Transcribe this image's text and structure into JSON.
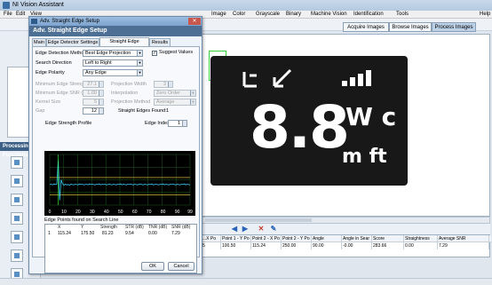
{
  "app": {
    "title": "NI Vision Assistant"
  },
  "menu": [
    "File",
    "Edit",
    "View",
    "Image",
    "Color",
    "Grayscale",
    "Binary",
    "Machine Vision",
    "Identification",
    "Tools",
    "Help"
  ],
  "view_buttons": [
    {
      "label": "Acquire Images",
      "active": false
    },
    {
      "label": "Browse Images",
      "active": false
    },
    {
      "label": "Process Images",
      "active": true
    }
  ],
  "left_panel": {
    "header": "Processing Functions"
  },
  "dialog": {
    "title": "Adv. Straight Edge Setup",
    "header": "Adv. Straight Edge Setup",
    "tabs": [
      "Main",
      "Edge Detector Settings",
      "Straight Edge Settings",
      "Results"
    ],
    "active_tab": "Straight Edge Settings",
    "edge_detection_method": {
      "label": "Edge Detection Method",
      "value": "Best Edge Projection"
    },
    "suggest_values": {
      "label": "Suggest Values",
      "checked": true
    },
    "search_direction": {
      "label": "Search Direction",
      "value": "Left to Right"
    },
    "edge_polarity": {
      "label": "Edge Polarity",
      "value": "Any Edge"
    },
    "minimum_edge_strength": {
      "label": "Minimum Edge Strength",
      "value": "27.1"
    },
    "minimum_edge_snr": {
      "label": "Minimum Edge SNR (dB)",
      "value": "1.00"
    },
    "kernel_size": {
      "label": "Kernel Size",
      "value": "5"
    },
    "gap": {
      "label": "Gap",
      "value": "12"
    },
    "projection_width": {
      "label": "Projection Width",
      "value": "3"
    },
    "interpolation": {
      "label": "Interpolation",
      "value": "Zero Order"
    },
    "projection_method": {
      "label": "Projection Method",
      "value": "Average"
    },
    "straight_edges_found": {
      "label": "Straight Edges Found:",
      "value": "1"
    },
    "profile_title": "Edge Strength Profile",
    "edge_index": {
      "label": "Edge Index",
      "value": "1"
    },
    "chart_x_ticks": [
      "0",
      "10",
      "20",
      "30",
      "40",
      "50",
      "60",
      "70",
      "80",
      "90",
      "99"
    ],
    "edge_points_title": "Edge Points found on Search Line",
    "edge_points_columns": [
      "X",
      "Y",
      "Strength",
      "STR (dB)",
      "TNR (dB)",
      "SNR (dB)"
    ],
    "edge_points_rows": [
      {
        "index": "1",
        "x": "115.24",
        "y": "175.50",
        "strength": "81.23",
        "str_db": "9.54",
        "tnr_db": "0.00",
        "snr_db": "7.29"
      }
    ],
    "ok_label": "OK",
    "cancel_label": "Cancel"
  },
  "lcd": {
    "digits": "8.8",
    "units_top": "W c",
    "units_bottom": "m ft"
  },
  "results_table": {
    "columns": [
      "...X Po",
      "Point 1 - Y Po",
      "Point 2 - X Po",
      "Point 2 - Y Po",
      "Angle",
      "Angle in Sear",
      "Score",
      "Straightness",
      "Average SNR"
    ],
    "rows": [
      [
        "5",
        "100.50",
        "115.24",
        "250.00",
        "90.00",
        "-0.00",
        "283.66",
        "0.00",
        "7.29"
      ]
    ]
  },
  "chart_data": {
    "type": "line",
    "title": "Edge Strength Profile",
    "xlim": [
      0,
      99
    ],
    "x_ticks": [
      0,
      10,
      20,
      30,
      40,
      50,
      60,
      70,
      80,
      90,
      99
    ],
    "series": [
      {
        "values": [
          5,
          6,
          4,
          7,
          5,
          6,
          82,
          -45,
          20,
          8,
          3,
          6,
          4,
          5,
          3,
          6,
          5,
          4,
          6,
          5,
          4,
          7,
          5,
          6,
          4,
          5,
          6,
          4,
          7,
          5,
          6,
          5,
          4,
          6,
          5,
          7,
          4,
          6,
          5,
          6,
          4,
          5,
          7,
          5,
          4,
          6,
          5,
          4,
          6,
          5,
          7,
          4,
          6,
          5,
          4,
          6,
          5,
          7,
          5,
          4,
          6,
          5,
          4,
          6,
          7,
          5,
          4,
          6,
          5,
          4,
          6,
          5,
          7,
          4,
          5,
          6,
          5,
          4,
          6,
          5,
          7,
          4,
          6,
          5,
          4,
          6,
          5,
          7,
          5,
          4,
          6,
          5,
          4,
          6,
          5,
          7,
          4,
          6,
          5,
          4
        ]
      }
    ],
    "threshold": 27.1,
    "grid": true,
    "colors": {
      "profile": "#3ad0ff",
      "threshold": "#ffd84a",
      "grid": "#1e5c1e",
      "marker": "#3aff3a"
    }
  }
}
